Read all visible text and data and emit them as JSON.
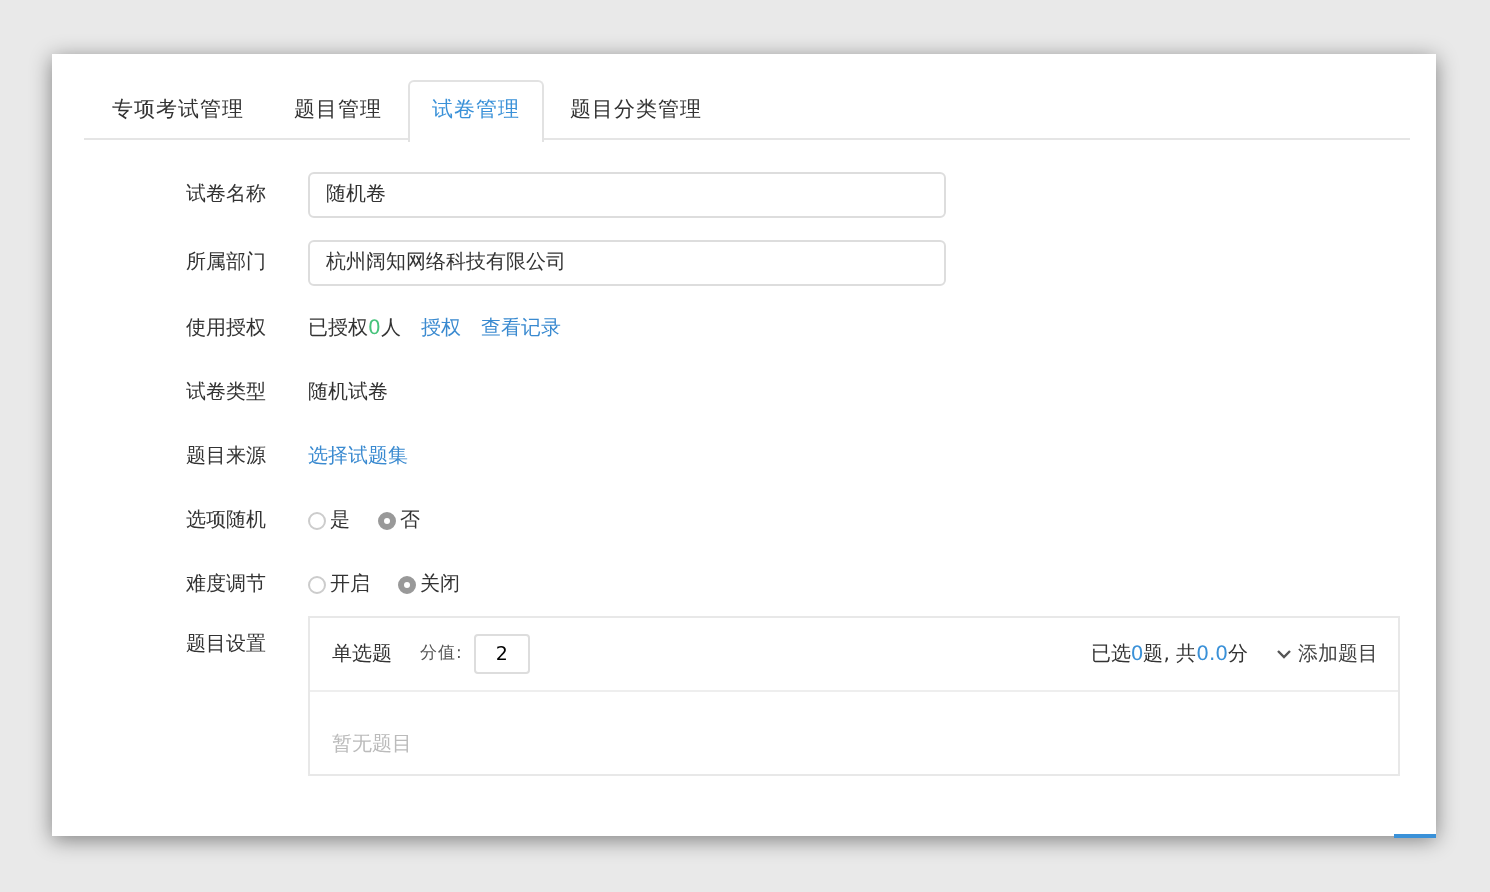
{
  "tabs": [
    {
      "label": "专项考试管理",
      "selected": false
    },
    {
      "label": "题目管理",
      "selected": false
    },
    {
      "label": "试卷管理",
      "selected": true
    },
    {
      "label": "题目分类管理",
      "selected": false
    }
  ],
  "form": {
    "name": {
      "label": "试卷名称",
      "value": "随机卷"
    },
    "department": {
      "label": "所属部门",
      "value": "杭州阔知网络科技有限公司"
    },
    "authorization": {
      "label": "使用授权",
      "status_prefix": "已授权",
      "count": "0",
      "status_suffix": "人",
      "links": [
        "授权",
        "查看记录"
      ]
    },
    "type": {
      "label": "试卷类型",
      "value": "随机试卷"
    },
    "source": {
      "label": "题目来源",
      "link": "选择试题集"
    },
    "option_random": {
      "label": "选项随机",
      "options": [
        {
          "label": "是",
          "selected": false
        },
        {
          "label": "否",
          "selected": true
        }
      ]
    },
    "difficulty": {
      "label": "难度调节",
      "options": [
        {
          "label": "开启",
          "selected": false
        },
        {
          "label": "关闭",
          "selected": true
        }
      ]
    },
    "question_settings": {
      "label": "题目设置",
      "section_title": "单选题",
      "score_label": "分值:",
      "score_value": "2",
      "summary": {
        "p1": "已选",
        "count": "0",
        "p2": "题, 共",
        "total": "0.0",
        "p3": "分"
      },
      "add_label": "添加题目",
      "empty_text": "暂无题目"
    }
  }
}
